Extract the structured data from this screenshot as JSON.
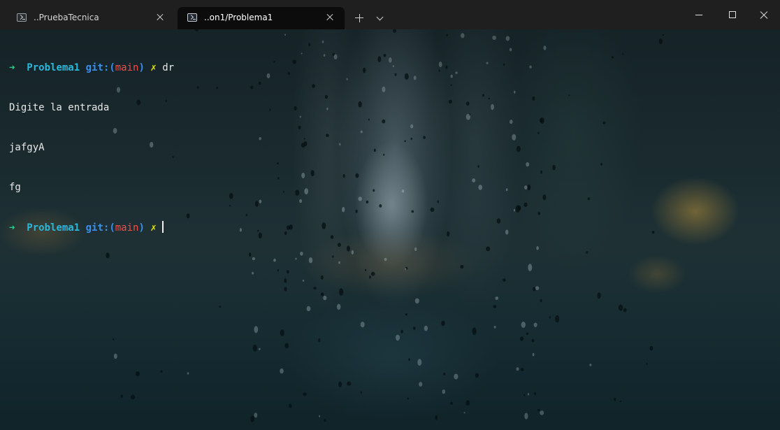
{
  "tabs": [
    {
      "title": "..PruebaTecnica",
      "active": false
    },
    {
      "title": "..on1/Problema1",
      "active": true
    }
  ],
  "terminal": {
    "lines": [
      {
        "type": "prompt",
        "arrow": "➜",
        "dir": "Problema1",
        "git_label": "git:",
        "open_paren": "(",
        "branch": "main",
        "close_paren": ")",
        "dirty": "✗",
        "command": "dr"
      },
      {
        "type": "output",
        "text": "Digite la entrada"
      },
      {
        "type": "output",
        "text": "jafgyA"
      },
      {
        "type": "output",
        "text": "fg"
      },
      {
        "type": "prompt",
        "arrow": "➜",
        "dir": "Problema1",
        "git_label": "git:",
        "open_paren": "(",
        "branch": "main",
        "close_paren": ")",
        "dirty": "✗",
        "command": ""
      }
    ]
  },
  "colors": {
    "arrow": "#23d18b",
    "dir": "#29b8db",
    "git": "#3b8eea",
    "branch": "#f14c4c",
    "dirty": "#e5e510",
    "text": "#e8e8e8",
    "titlebar": "#1f1f1f",
    "active_tab": "#0c0c0c"
  },
  "icons": {
    "tab_icon": "powershell-icon",
    "tab_close": "close-icon",
    "new_tab": "plus-icon",
    "dropdown": "chevron-down-icon",
    "minimize": "minimize-icon",
    "maximize": "maximize-icon",
    "close": "close-icon"
  }
}
